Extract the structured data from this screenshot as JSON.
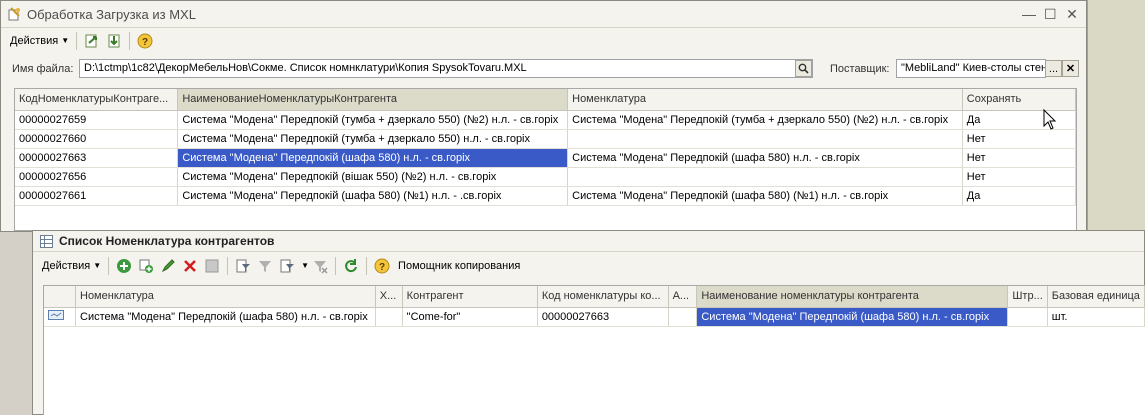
{
  "main_window": {
    "title": "Обработка  Загрузка из MXL",
    "toolbar": {
      "actions_label": "Действия"
    },
    "file_label": "Имя файла:",
    "file_value": "D:\\1ctmp\\1c82\\ДекорМебельНов\\Сокме. Список номнклатури\\Копия SpysokTovaru.MXL",
    "supplier_label": "Поставщик:",
    "supplier_value": "\"MebliLand\" Киев-столы стен",
    "columns": [
      "КодНоменклатурыКонтраге...",
      "НаименованиеНоменклатурыКонтрагента",
      "Номенклатура",
      "Сохранять"
    ],
    "rows": [
      [
        "00000027659",
        "Система \"Модена\" Передпокій (тумба + дзеркало 550) (№2) н.л. - св.горіх",
        "Система \"Модена\" Передпокій (тумба + дзеркало 550) (№2) н.л. - св.горіх",
        "Да"
      ],
      [
        "00000027660",
        "Система \"Модена\" Передпокій (тумба + дзеркало 550) н.л. - св.горіх",
        "",
        "Нет"
      ],
      [
        "00000027663",
        "Система \"Модена\" Передпокій (шафа 580) н.л. - св.горіх",
        "Система \"Модена\" Передпокій (шафа 580) н.л. - св.горіх",
        "Нет"
      ],
      [
        "00000027656",
        "Система \"Модена\" Передпокій (вішак 550) (№2) н.л. - св.горіх",
        "",
        "Нет"
      ],
      [
        "00000027661",
        "Система \"Модена\" Передпокій (шафа 580) (№1) н.л. - .св.горіх",
        "Система \"Модена\" Передпокій (шафа 580) (№1) н.л. -  св.горіх",
        "Да"
      ]
    ]
  },
  "list_window": {
    "title": "Список Номенклатура контрагентов",
    "toolbar": {
      "actions_label": "Действия",
      "copy_helper_label": "Помощник копирования"
    },
    "columns": [
      "Номенклатура",
      "Х...",
      "Контрагент",
      "Код номенклатуры ко...",
      "А...",
      "Наименование номенклатуры контрагента",
      "Штр...",
      "Базовая единица"
    ],
    "rows": [
      [
        "Система \"Модена\" Передпокій (шафа 580) н.л. - св.горіх",
        "",
        "\"Come-for\"",
        "00000027663",
        "",
        "Система \"Модена\" Передпокій (шафа 580) н.л. - св.горіх",
        "",
        "шт."
      ]
    ]
  },
  "colors": {
    "selection": "#3a5bc7",
    "sorted_header": "#dcdac9",
    "window_bg": "#f4f3ee"
  }
}
